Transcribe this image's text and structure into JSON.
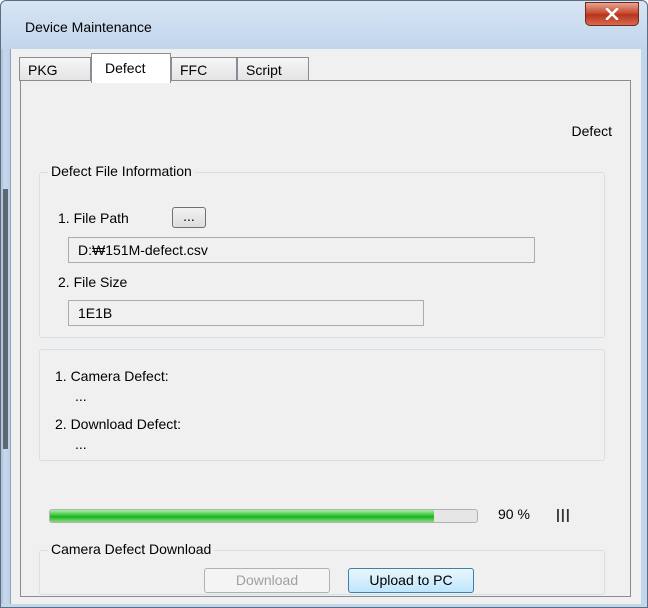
{
  "window": {
    "title": "Device Maintenance",
    "close_label": "X"
  },
  "tabs": [
    {
      "label": "PKG",
      "active": false
    },
    {
      "label": "Defect",
      "active": true
    },
    {
      "label": "FFC",
      "active": false
    },
    {
      "label": "Script",
      "active": false
    }
  ],
  "panel": {
    "heading": "Defect",
    "file_info": {
      "title": "Defect File Information",
      "file_path_label": "1. File Path",
      "browse_label": "...",
      "file_path_value": "D:₩151M-defect.csv",
      "file_size_label": "2. File Size",
      "file_size_value": "1E1B"
    },
    "defects": {
      "camera_label": "1. Camera Defect:",
      "camera_value": "...",
      "download_label": "2. Download Defect:",
      "download_value": "..."
    },
    "progress": {
      "value": 90,
      "text": "90 %",
      "indicator": "|||"
    },
    "download_group": {
      "title": "Camera Defect Download",
      "download_label": "Download",
      "upload_label": "Upload to PC"
    }
  },
  "colors": {
    "progress_fill": "#22b022",
    "close_button": "#c7472c"
  },
  "icons": {
    "close": "close-icon"
  }
}
